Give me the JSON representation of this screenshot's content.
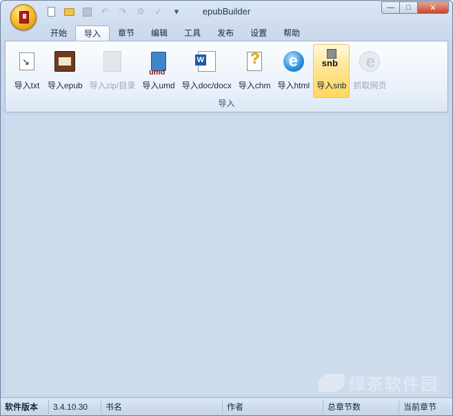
{
  "window": {
    "title": "epubBuilder",
    "controls": {
      "minimize": "—",
      "maximize": "□",
      "close": "✕"
    }
  },
  "quick_access": [
    {
      "name": "new-doc-icon"
    },
    {
      "name": "open-folder-icon"
    },
    {
      "name": "save-icon"
    },
    {
      "name": "undo-icon",
      "glyph": "↶"
    },
    {
      "name": "redo-icon",
      "glyph": "↷"
    },
    {
      "name": "settings-icon",
      "glyph": "⚙"
    },
    {
      "name": "check-icon",
      "glyph": "✓"
    },
    {
      "name": "customize-dropdown-icon",
      "glyph": "▾"
    }
  ],
  "tabs": [
    "开始",
    "导入",
    "章节",
    "编辑",
    "工具",
    "发布",
    "设置",
    "帮助"
  ],
  "active_tab": "导入",
  "ribbon": {
    "group_label": "导入",
    "buttons": [
      {
        "label": "导入txt",
        "icon": "import-txt-icon"
      },
      {
        "label": "导入epub",
        "icon": "import-epub-icon"
      },
      {
        "label": "导入zip/目录",
        "icon": "import-zip-icon",
        "disabled": true
      },
      {
        "label": "导入umd",
        "icon": "import-umd-icon",
        "icon_text": "umd"
      },
      {
        "label": "导入doc/docx",
        "icon": "import-doc-icon"
      },
      {
        "label": "导入chm",
        "icon": "import-chm-icon"
      },
      {
        "label": "导入html",
        "icon": "import-html-icon"
      },
      {
        "label": "导入snb",
        "icon": "import-snb-icon",
        "icon_text": "snb",
        "hover": true
      },
      {
        "label": "抓取网页",
        "icon": "grab-webpage-icon",
        "disabled": true
      }
    ]
  },
  "statusbar": {
    "version_label": "软件版本",
    "version_value": "3.4.10.30",
    "book_label": "书名",
    "author_label": "作者",
    "chapter_count_label": "总章节数",
    "current_chapter_label": "当前章节"
  },
  "watermark": {
    "text": "绿茶软件园"
  },
  "colors": {
    "accent": "#ffd85e",
    "workspace": "#cfdcee",
    "border": "#9db2cf"
  }
}
